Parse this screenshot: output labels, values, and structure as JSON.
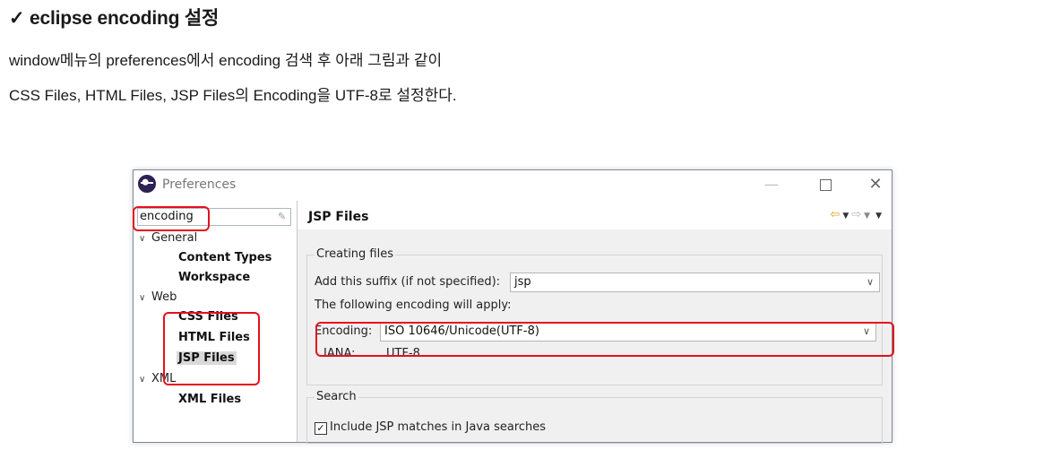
{
  "doc": {
    "heading": "✓ eclipse encoding 설정",
    "line1": "window메뉴의 preferences에서 encoding 검색 후 아래 그림과 같이",
    "line2": "CSS Files, HTML Files, JSP Files의 Encoding을 UTF-8로 설정한다."
  },
  "window": {
    "title": "Preferences",
    "app_icon": "eclipse-icon",
    "controls": {
      "minimize": "—",
      "maximize_icon": "maximize-icon",
      "close": "✕"
    }
  },
  "left": {
    "filter_value": "encoding",
    "clear_icon": "clear-filter-icon",
    "tree": [
      {
        "label": "General",
        "expanded": true,
        "children": [
          "Content Types",
          "Workspace"
        ]
      },
      {
        "label": "Web",
        "expanded": true,
        "children": [
          "CSS Files",
          "HTML Files",
          "JSP Files"
        ]
      },
      {
        "label": "XML",
        "expanded": true,
        "children": [
          "XML Files"
        ]
      }
    ],
    "selected": "JSP Files"
  },
  "right": {
    "title": "JSP Files",
    "nav": {
      "back_icon": "back-arrow-icon",
      "forward_icon": "forward-arrow-icon",
      "dropdown_icon": "chevron-down-icon"
    },
    "creating": {
      "group_label": "Creating files",
      "suffix_label": "Add this suffix (if not specified):",
      "suffix_value": "jsp",
      "encoding_note": "The following encoding will apply:",
      "encoding_label": "Encoding:",
      "encoding_value": "ISO 10646/Unicode(UTF-8)",
      "iana_label": "IANA:",
      "iana_value": "UTF-8"
    },
    "search": {
      "group_label": "Search",
      "checkbox_label": "Include JSP matches in Java searches",
      "checked": true
    }
  },
  "colors": {
    "highlight": "#e5101d",
    "pane_bg": "#f0f0f0"
  }
}
